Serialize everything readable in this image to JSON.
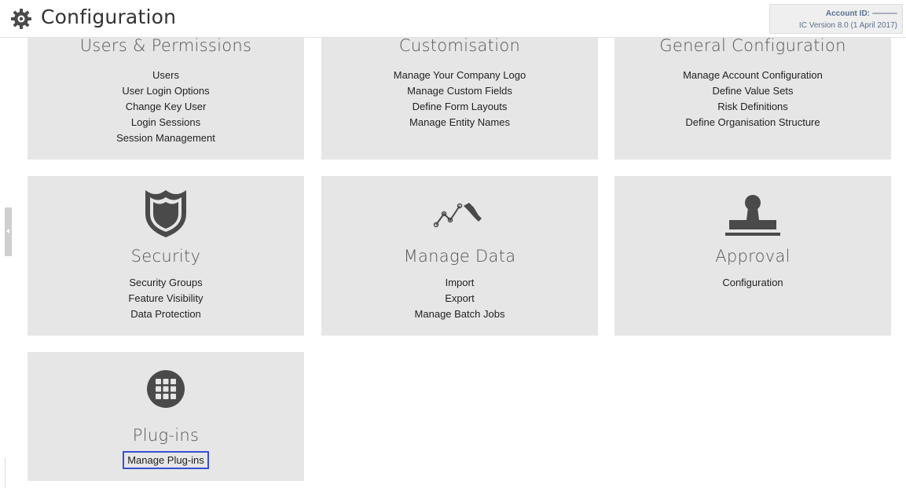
{
  "header": {
    "title": "Configuration",
    "gear_icon": "gear-icon",
    "account_label": "Account ID:",
    "version": "IC Version 8.0 (1 April 2017)"
  },
  "cards": {
    "users": {
      "title": "Users & Permissions",
      "links": [
        "Users",
        "User Login Options",
        "Change Key User",
        "Login Sessions",
        "Session Management"
      ]
    },
    "customisation": {
      "title": "Customisation",
      "links": [
        "Manage Your Company Logo",
        "Manage Custom Fields",
        "Define Form Layouts",
        "Manage Entity Names"
      ]
    },
    "general": {
      "title": "General Configuration",
      "links": [
        "Manage Account Configuration",
        "Define Value Sets",
        "Risk Definitions",
        "Define Organisation Structure"
      ]
    },
    "security": {
      "title": "Security",
      "icon": "shield-icon",
      "links": [
        "Security Groups",
        "Feature Visibility",
        "Data Protection"
      ]
    },
    "manage_data": {
      "title": "Manage Data",
      "icon": "data-tools-icon",
      "links": [
        "Import",
        "Export",
        "Manage Batch Jobs"
      ]
    },
    "approval": {
      "title": "Approval",
      "icon": "stamp-icon",
      "links": [
        "Configuration"
      ]
    },
    "plugins": {
      "title": "Plug-ins",
      "icon": "grid-icon",
      "links": [
        "Manage Plug-ins"
      ]
    }
  },
  "colors": {
    "card_bg": "#e6e6e6",
    "icon_dark": "#4a4a4a",
    "highlight_border": "#3a4fd6",
    "account_text": "#5a6f8f"
  }
}
